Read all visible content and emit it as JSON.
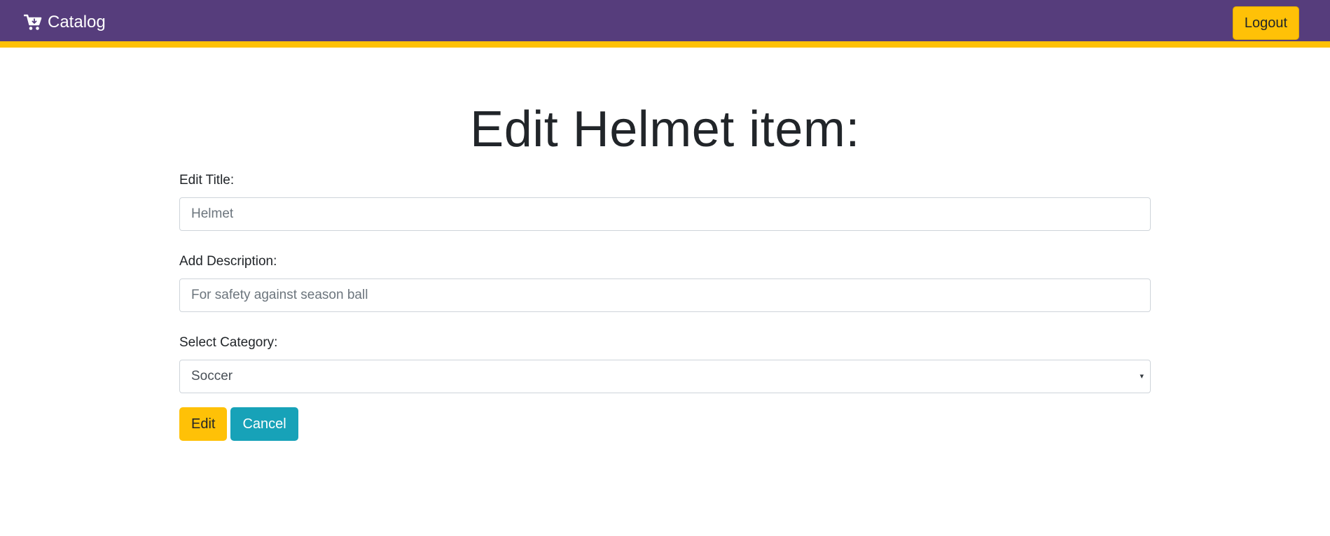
{
  "navbar": {
    "brand_label": "Catalog",
    "brand_icon": "shopping-cart-icon",
    "logout_label": "Logout",
    "background_color": "#563d7c",
    "accent_color": "#ffc107"
  },
  "page": {
    "title": "Edit Helmet item:"
  },
  "form": {
    "title_field": {
      "label": "Edit Title:",
      "placeholder": "Helmet"
    },
    "description_field": {
      "label": "Add Description:",
      "placeholder": "For safety against season ball"
    },
    "category_field": {
      "label": "Select Category:",
      "selected": "Soccer"
    },
    "edit_button_label": "Edit",
    "cancel_button_label": "Cancel"
  }
}
